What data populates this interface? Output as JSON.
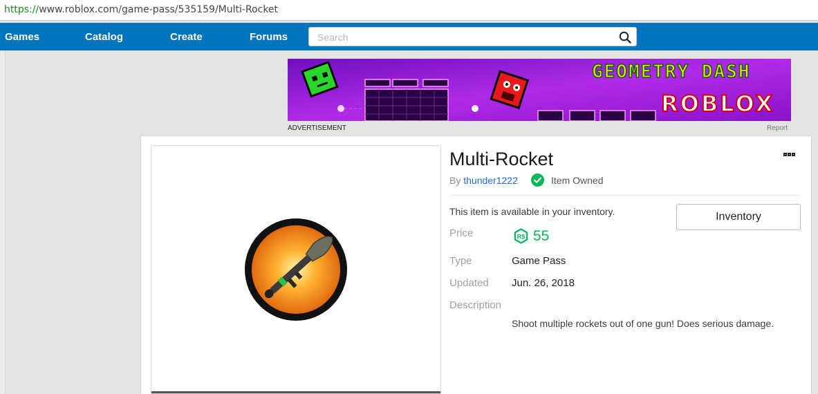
{
  "browser": {
    "url_scheme": "https://",
    "url_rest": "www.roblox.com/game-pass/535159/Multi-Rocket"
  },
  "nav": {
    "links": [
      "Games",
      "Catalog",
      "Create",
      "Forums"
    ],
    "search_placeholder": "Search"
  },
  "ad": {
    "label": "ADVERTISEMENT",
    "report": "Report",
    "banner_line1": "GEOMETRY DASH",
    "banner_line2": "ROBLOX"
  },
  "item": {
    "title": "Multi-Rocket",
    "by_prefix": "By",
    "creator": "thunder1222",
    "owned_text": "Item Owned",
    "availability": "This item is available in your inventory.",
    "inventory_button": "Inventory",
    "price_label": "Price",
    "price": "55",
    "type_label": "Type",
    "type": "Game Pass",
    "updated_label": "Updated",
    "updated": "Jun. 26, 2018",
    "description_label": "Description",
    "description": "Shoot multiple rockets out of one gun! Does serious damage."
  },
  "colors": {
    "nav_blue": "#0074bd",
    "robux_green": "#02b757",
    "link_blue": "#1e6bc9"
  }
}
